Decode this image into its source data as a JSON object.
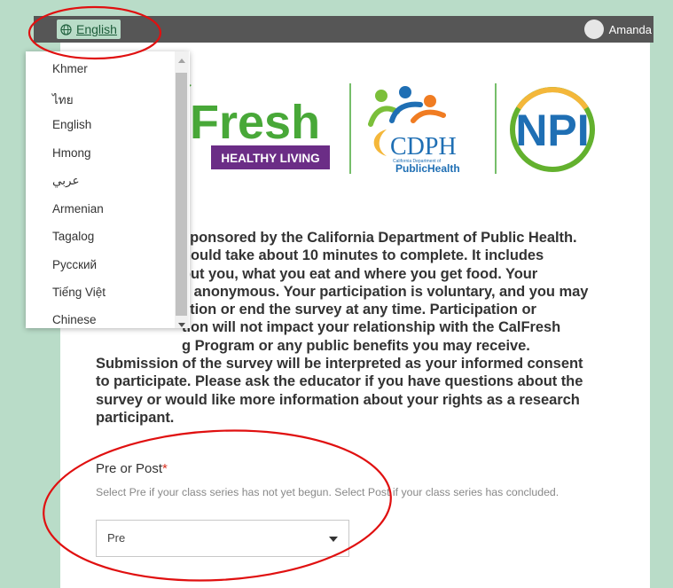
{
  "header": {
    "language_button_label": "English",
    "user_name": "Amanda"
  },
  "language_menu": {
    "items": [
      "Khmer",
      "ไทย",
      "English",
      "Hmong",
      "عربي",
      "Armenian",
      "Tagalog",
      "Русский",
      "Tiếng Việt",
      "Chinese"
    ]
  },
  "logos": {
    "calfresh_text": "Fresh",
    "calfresh_tagline": "HEALTHY LIVING",
    "cdph_text": "CDPH",
    "cdph_small": "California Department of",
    "cdph_sub": "PublicHealth",
    "npi_text": "NPI"
  },
  "intro": {
    "lines": [
      "sponsored by the California Department of Public Health.",
      "hould take about 10 minutes to complete. It includes",
      "out you, what you eat and where you get food. Your",
      "e anonymous. Your participation is voluntary, and you may",
      "stion or end the survey at any time. Participation or",
      "tion will not impact your relationship with the CalFresh",
      "g Program or any public benefits you may receive.",
      "Submission of the survey will be interpreted as your informed consent",
      "to participate. Please ask the educator if you have questions about the",
      "survey or would like more information about your rights as a research",
      "participant."
    ]
  },
  "question": {
    "title": "Pre or Post",
    "required_mark": "*",
    "description": "Select Pre if your class series has not yet begun. Select Post if your class series has concluded.",
    "selected_value": "Pre"
  },
  "colors": {
    "page_background": "#b9dcc8",
    "top_bar": "#565656",
    "annotation_red": "#e01010",
    "calfresh_green": "#48a838",
    "calfresh_purple": "#6b2d86",
    "cdph_blue": "#1f6fb4",
    "npi_green": "#63b12e"
  }
}
